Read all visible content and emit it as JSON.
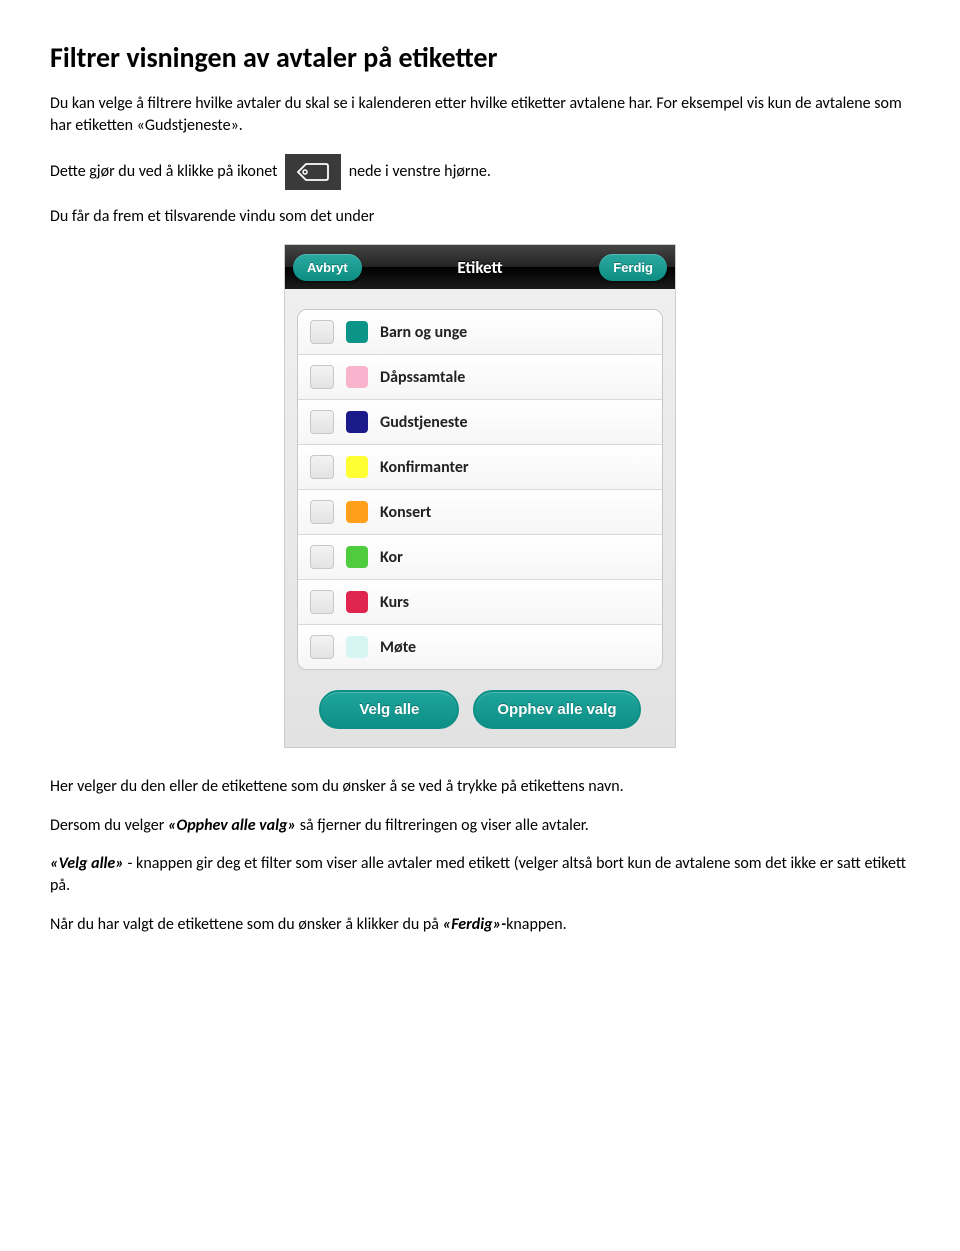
{
  "doc": {
    "heading": "Filtrer visningen av avtaler på etiketter",
    "p1": "Du kan velge å filtrere hvilke avtaler du skal se i kalenderen etter hvilke etiketter avtalene har. For eksempel vis kun de avtalene som har etiketten «Gudstjeneste».",
    "p2a": "Dette gjør du ved å klikke på ikonet ",
    "p2b": " nede i venstre hjørne.",
    "p3": "Du får da frem et tilsvarende vindu som det under",
    "p4": "Her velger du den eller de etikettene som du ønsker å se ved å trykke på etikettens navn.",
    "p5a": "Dersom du velger ",
    "p5b": "«Opphev alle valg»",
    "p5c": " så fjerner du filtreringen og viser alle avtaler.",
    "p6a": "«Velg alle»",
    "p6b": " - knappen gir deg et filter som viser alle avtaler med etikett (velger altså bort kun de avtalene som det ikke er satt etikett på.",
    "p7a": "Når du har valgt de etikettene som du ønsker å klikker du på ",
    "p7b": "«Ferdig»-",
    "p7c": "knappen."
  },
  "modal": {
    "cancel": "Avbryt",
    "title": "Etikett",
    "done": "Ferdig",
    "tags": [
      {
        "label": "Barn og unge",
        "color": "#0d9488"
      },
      {
        "label": "Dåpssamtale",
        "color": "#f8b4cc"
      },
      {
        "label": "Gudstjeneste",
        "color": "#1a1a8a"
      },
      {
        "label": "Konfirmanter",
        "color": "#ffff33"
      },
      {
        "label": "Konsert",
        "color": "#ff9f1a"
      },
      {
        "label": "Kor",
        "color": "#4ecc3e"
      },
      {
        "label": "Kurs",
        "color": "#e0264f"
      },
      {
        "label": "Møte",
        "color": "#d6f5f3"
      }
    ],
    "selectAll": "Velg alle",
    "clearAll": "Opphev alle valg"
  }
}
